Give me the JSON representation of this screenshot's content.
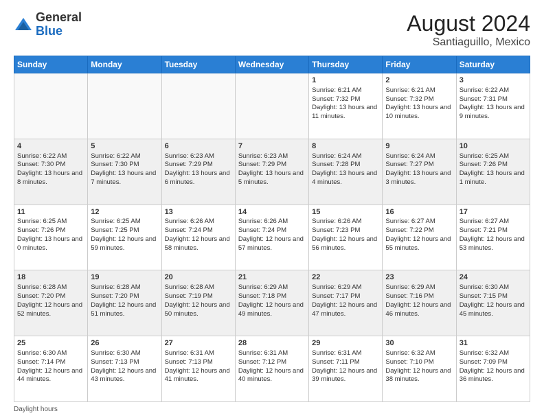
{
  "header": {
    "logo_general": "General",
    "logo_blue": "Blue",
    "month_year": "August 2024",
    "location": "Santiaguillo, Mexico"
  },
  "footer": {
    "note": "Daylight hours"
  },
  "weekdays": [
    "Sunday",
    "Monday",
    "Tuesday",
    "Wednesday",
    "Thursday",
    "Friday",
    "Saturday"
  ],
  "weeks": [
    [
      {
        "day": "",
        "content": ""
      },
      {
        "day": "",
        "content": ""
      },
      {
        "day": "",
        "content": ""
      },
      {
        "day": "",
        "content": ""
      },
      {
        "day": "1",
        "content": "Sunrise: 6:21 AM\nSunset: 7:32 PM\nDaylight: 13 hours and 11 minutes."
      },
      {
        "day": "2",
        "content": "Sunrise: 6:21 AM\nSunset: 7:32 PM\nDaylight: 13 hours and 10 minutes."
      },
      {
        "day": "3",
        "content": "Sunrise: 6:22 AM\nSunset: 7:31 PM\nDaylight: 13 hours and 9 minutes."
      }
    ],
    [
      {
        "day": "4",
        "content": "Sunrise: 6:22 AM\nSunset: 7:30 PM\nDaylight: 13 hours and 8 minutes."
      },
      {
        "day": "5",
        "content": "Sunrise: 6:22 AM\nSunset: 7:30 PM\nDaylight: 13 hours and 7 minutes."
      },
      {
        "day": "6",
        "content": "Sunrise: 6:23 AM\nSunset: 7:29 PM\nDaylight: 13 hours and 6 minutes."
      },
      {
        "day": "7",
        "content": "Sunrise: 6:23 AM\nSunset: 7:29 PM\nDaylight: 13 hours and 5 minutes."
      },
      {
        "day": "8",
        "content": "Sunrise: 6:24 AM\nSunset: 7:28 PM\nDaylight: 13 hours and 4 minutes."
      },
      {
        "day": "9",
        "content": "Sunrise: 6:24 AM\nSunset: 7:27 PM\nDaylight: 13 hours and 3 minutes."
      },
      {
        "day": "10",
        "content": "Sunrise: 6:25 AM\nSunset: 7:26 PM\nDaylight: 13 hours and 1 minute."
      }
    ],
    [
      {
        "day": "11",
        "content": "Sunrise: 6:25 AM\nSunset: 7:26 PM\nDaylight: 13 hours and 0 minutes."
      },
      {
        "day": "12",
        "content": "Sunrise: 6:25 AM\nSunset: 7:25 PM\nDaylight: 12 hours and 59 minutes."
      },
      {
        "day": "13",
        "content": "Sunrise: 6:26 AM\nSunset: 7:24 PM\nDaylight: 12 hours and 58 minutes."
      },
      {
        "day": "14",
        "content": "Sunrise: 6:26 AM\nSunset: 7:24 PM\nDaylight: 12 hours and 57 minutes."
      },
      {
        "day": "15",
        "content": "Sunrise: 6:26 AM\nSunset: 7:23 PM\nDaylight: 12 hours and 56 minutes."
      },
      {
        "day": "16",
        "content": "Sunrise: 6:27 AM\nSunset: 7:22 PM\nDaylight: 12 hours and 55 minutes."
      },
      {
        "day": "17",
        "content": "Sunrise: 6:27 AM\nSunset: 7:21 PM\nDaylight: 12 hours and 53 minutes."
      }
    ],
    [
      {
        "day": "18",
        "content": "Sunrise: 6:28 AM\nSunset: 7:20 PM\nDaylight: 12 hours and 52 minutes."
      },
      {
        "day": "19",
        "content": "Sunrise: 6:28 AM\nSunset: 7:20 PM\nDaylight: 12 hours and 51 minutes."
      },
      {
        "day": "20",
        "content": "Sunrise: 6:28 AM\nSunset: 7:19 PM\nDaylight: 12 hours and 50 minutes."
      },
      {
        "day": "21",
        "content": "Sunrise: 6:29 AM\nSunset: 7:18 PM\nDaylight: 12 hours and 49 minutes."
      },
      {
        "day": "22",
        "content": "Sunrise: 6:29 AM\nSunset: 7:17 PM\nDaylight: 12 hours and 47 minutes."
      },
      {
        "day": "23",
        "content": "Sunrise: 6:29 AM\nSunset: 7:16 PM\nDaylight: 12 hours and 46 minutes."
      },
      {
        "day": "24",
        "content": "Sunrise: 6:30 AM\nSunset: 7:15 PM\nDaylight: 12 hours and 45 minutes."
      }
    ],
    [
      {
        "day": "25",
        "content": "Sunrise: 6:30 AM\nSunset: 7:14 PM\nDaylight: 12 hours and 44 minutes."
      },
      {
        "day": "26",
        "content": "Sunrise: 6:30 AM\nSunset: 7:13 PM\nDaylight: 12 hours and 43 minutes."
      },
      {
        "day": "27",
        "content": "Sunrise: 6:31 AM\nSunset: 7:13 PM\nDaylight: 12 hours and 41 minutes."
      },
      {
        "day": "28",
        "content": "Sunrise: 6:31 AM\nSunset: 7:12 PM\nDaylight: 12 hours and 40 minutes."
      },
      {
        "day": "29",
        "content": "Sunrise: 6:31 AM\nSunset: 7:11 PM\nDaylight: 12 hours and 39 minutes."
      },
      {
        "day": "30",
        "content": "Sunrise: 6:32 AM\nSunset: 7:10 PM\nDaylight: 12 hours and 38 minutes."
      },
      {
        "day": "31",
        "content": "Sunrise: 6:32 AM\nSunset: 7:09 PM\nDaylight: 12 hours and 36 minutes."
      }
    ]
  ]
}
